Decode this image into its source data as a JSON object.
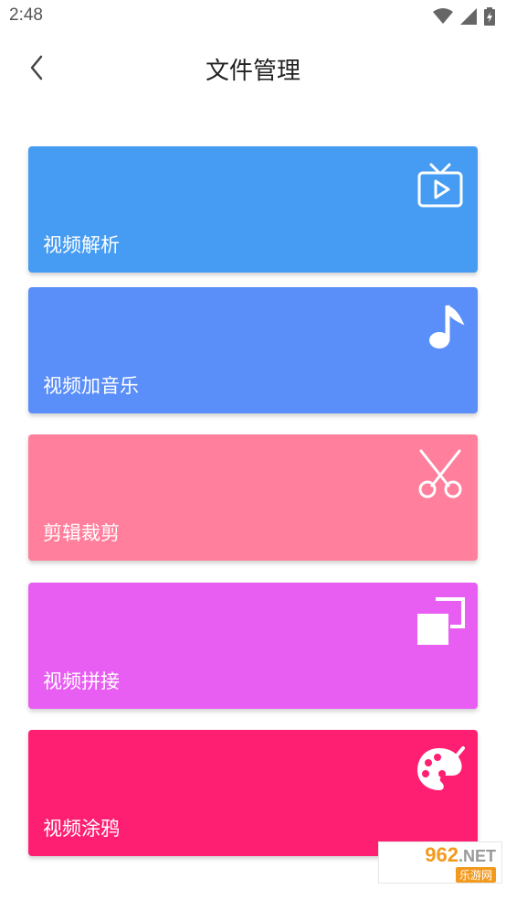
{
  "status_bar": {
    "time": "2:48"
  },
  "header": {
    "title": "文件管理"
  },
  "cards": [
    {
      "label": "视频解析",
      "icon": "tv-play-icon",
      "color": "#469cf2"
    },
    {
      "label": "视频加音乐",
      "icon": "music-note-icon",
      "color": "#5a8ef9"
    },
    {
      "label": "剪辑裁剪",
      "icon": "scissors-icon",
      "color": "#ff7f9c"
    },
    {
      "label": "视频拼接",
      "icon": "overlap-squares-icon",
      "color": "#e85ef2"
    },
    {
      "label": "视频涂鸦",
      "icon": "palette-icon",
      "color": "#ff1f72"
    }
  ],
  "watermark": {
    "main_number": "962",
    "main_suffix": ".NET",
    "sub": "乐游网"
  }
}
